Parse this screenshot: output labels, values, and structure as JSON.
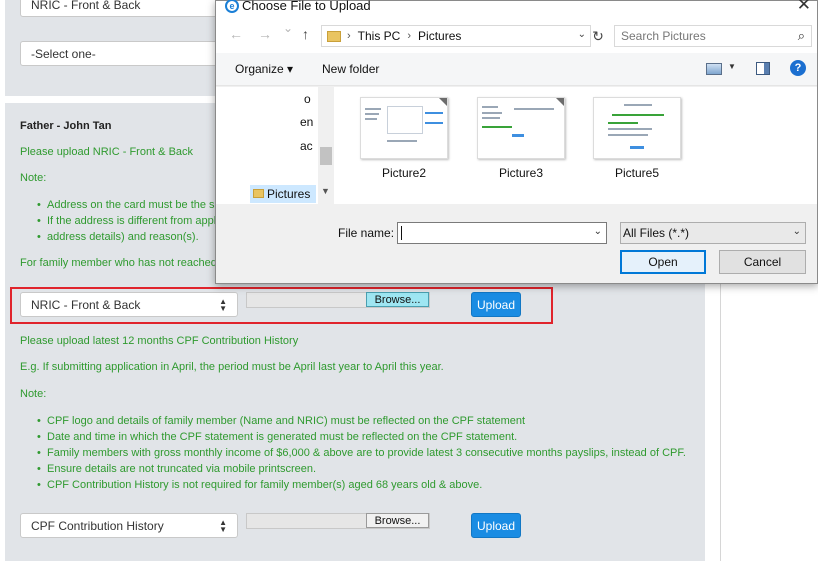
{
  "form": {
    "top_select_value": "NRIC - Front & Back",
    "top_select2_value": "-Select one-",
    "section_title": "Father - John Tan",
    "nric_instruction": "Please upload NRIC - Front & Back",
    "note_label": "Note:",
    "nric_notes": [
      "Address on the card must be the sa",
      "If the address is different from applic",
      "address details) and reason(s)."
    ],
    "family_member_text": "For family member who has not reached a",
    "nric_select_value": "NRIC - Front & Back",
    "browse_label": "Browse...",
    "upload_label": "Upload",
    "cpf_instruction": "Please upload latest 12 months CPF Contribution History",
    "cpf_example": "E.g. If submitting application in April, the period must be April last year to April this year.",
    "cpf_note_label": "Note:",
    "cpf_notes": [
      "CPF logo and details of family member (Name and NRIC) must be reflected on the CPF statement",
      "Date and time in which the CPF statement is generated must be reflected on the CPF statement.",
      "Family members with gross monthly income of $6,000 & above are to provide latest 3 consecutive months payslips, instead of CPF.",
      "Ensure details are not truncated via mobile printscreen.",
      "CPF Contribution History is not required for family member(s) aged 68 years old & above."
    ],
    "cpf_select_value": "CPF Contribution History",
    "cpf_browse_label": "Browse...",
    "cpf_upload_label": "Upload"
  },
  "dialog": {
    "title": "Choose File to Upload",
    "close_glyph": "✕",
    "back_glyph": "←",
    "forward_glyph": "→",
    "recent_glyph": "⌄",
    "up_glyph": "↑",
    "refresh_glyph": "↻",
    "path": [
      "This PC",
      "Pictures"
    ],
    "search_placeholder": "Search Pictures",
    "organize_label": "Organize ▾",
    "new_folder_label": "New folder",
    "help_glyph": "?",
    "nav_fragments": [
      "o",
      "en",
      "ac"
    ],
    "nav_selected": "Pictures",
    "files": [
      "Picture2",
      "Picture3",
      "Picture5"
    ],
    "file_name_label": "File name:",
    "file_name_value": "",
    "filter_value": "All Files (*.*)",
    "open_label": "Open",
    "cancel_label": "Cancel"
  },
  "colors": {
    "green_text": "#2f9a2f",
    "upload_button": "#1a8ce3",
    "highlight_box": "#e0242c",
    "browse_highlight": "#9ee6f2",
    "dialog_accent": "#0078d7"
  }
}
